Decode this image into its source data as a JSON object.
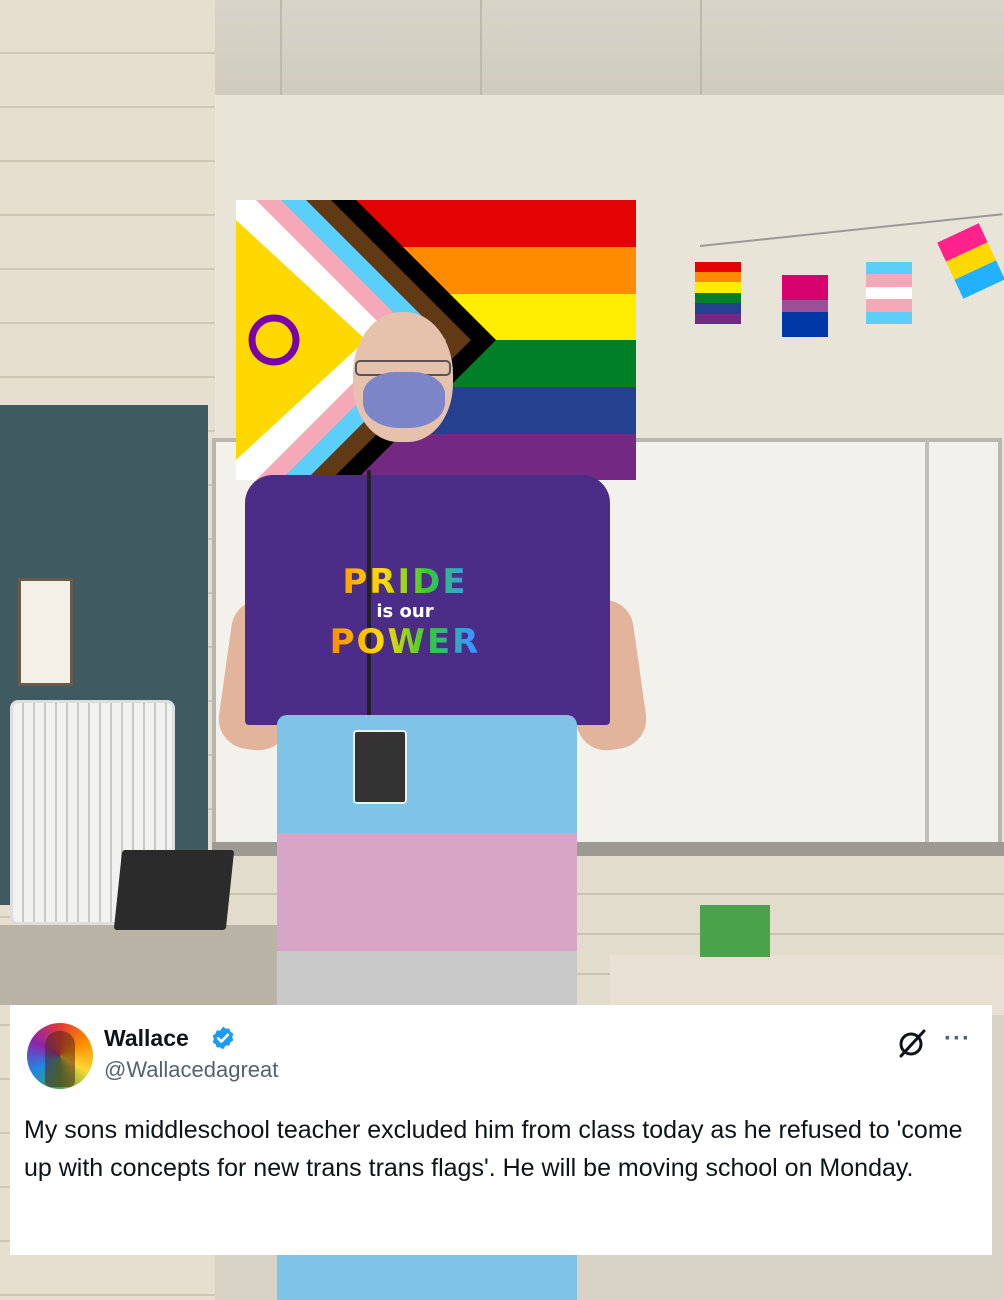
{
  "tweet": {
    "display_name": "Wallace",
    "handle": "@Wallacedagreat",
    "text": "My sons middleschool teacher excluded him from class today as he refused to 'come up with concepts for new trans trans flags'. He will be moving school on Monday.",
    "icons": {
      "verified": "verified-badge-icon",
      "grok": "grok-icon",
      "more": "more-icon"
    },
    "colors": {
      "verified": "#1d9bf0",
      "text": "#0f1419",
      "handle": "#536471"
    }
  },
  "photo": {
    "shirt_line1": "PRIDE",
    "shirt_line2": "is our",
    "shirt_line3": "POWER",
    "flag_colors": [
      "#e40303",
      "#ff8c00",
      "#ffed00",
      "#008026",
      "#24408e",
      "#732982"
    ],
    "trans_colors": [
      "#5bcefa",
      "#f5a9b8",
      "#ffffff",
      "#f5a9b8",
      "#5bcefa"
    ]
  }
}
